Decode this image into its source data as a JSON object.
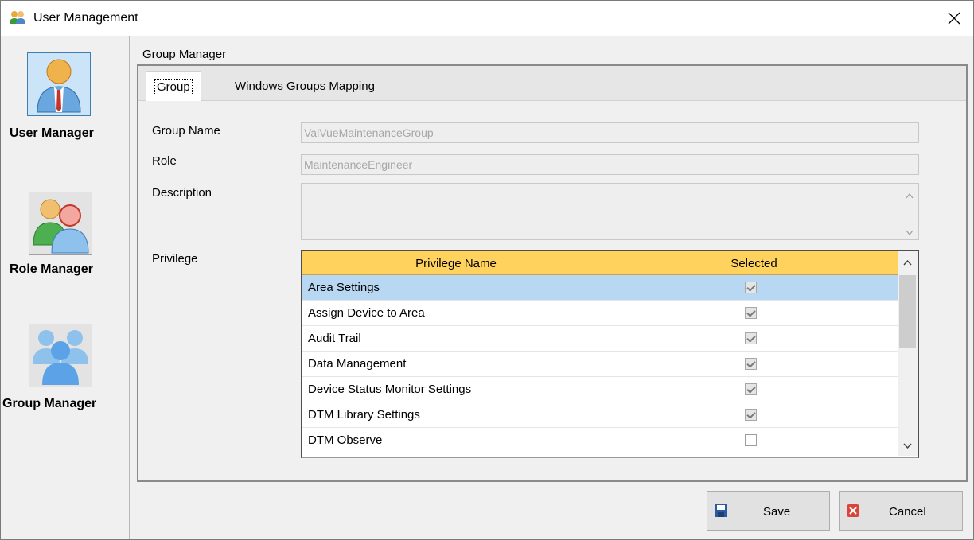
{
  "window": {
    "title": "User Management",
    "close_symbol": "✕"
  },
  "sidebar": {
    "items": [
      {
        "label": "User Manager",
        "icon": "single-user-icon",
        "active": true
      },
      {
        "label": "Role Manager",
        "icon": "two-users-icon",
        "active": false
      },
      {
        "label": "Group Manager",
        "icon": "user-group-icon",
        "active": false
      }
    ]
  },
  "group_manager": {
    "groupbox_title": "Group Manager",
    "tabs": [
      {
        "label": "Group",
        "active": true
      },
      {
        "label": "Windows Groups Mapping",
        "active": false
      }
    ],
    "fields": {
      "group_name_label": "Group Name",
      "group_name_value": "ValVueMaintenanceGroup",
      "role_label": "Role",
      "role_value": "MaintenanceEngineer",
      "description_label": "Description",
      "description_value": "",
      "privilege_label": "Privilege"
    },
    "privilege_grid": {
      "columns": [
        "Privilege Name",
        "Selected"
      ],
      "rows": [
        {
          "name": "Area Settings",
          "selected": true,
          "highlighted": true
        },
        {
          "name": "Assign Device to Area",
          "selected": true,
          "highlighted": false
        },
        {
          "name": "Audit Trail",
          "selected": true,
          "highlighted": false
        },
        {
          "name": "Data Management",
          "selected": true,
          "highlighted": false
        },
        {
          "name": "Device Status Monitor Settings",
          "selected": true,
          "highlighted": false
        },
        {
          "name": "DTM Library Settings",
          "selected": true,
          "highlighted": false
        },
        {
          "name": "DTM Observe",
          "selected": false,
          "highlighted": false
        }
      ],
      "scroll_up_symbol": "^",
      "scroll_down_symbol": "v"
    }
  },
  "buttons": {
    "save_label": "Save",
    "cancel_label": "Cancel"
  },
  "colors": {
    "grid_header": "#ffd25e",
    "row_highlight": "#b7d7f2",
    "active_nav": "#cce4f7",
    "save_icon": "#2c5aa0",
    "cancel_icon": "#d9443b"
  }
}
